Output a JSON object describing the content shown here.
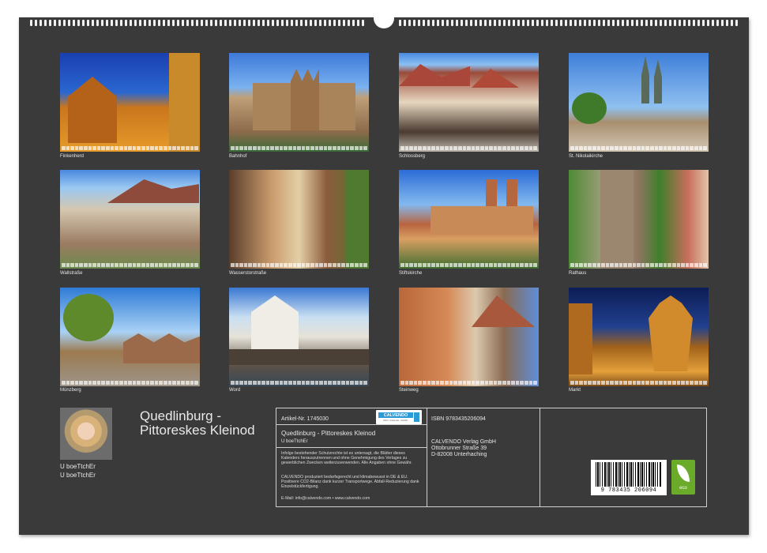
{
  "tiles": [
    {
      "label": "Finkenherd"
    },
    {
      "label": "Bahnhof"
    },
    {
      "label": "Schlossberg"
    },
    {
      "label": "St. Nikolaikirche"
    },
    {
      "label": "Wallstraße"
    },
    {
      "label": "Wasserstorstraße"
    },
    {
      "label": "Stiftskirche"
    },
    {
      "label": "Rathaus"
    },
    {
      "label": "Münzberg"
    },
    {
      "label": "Word"
    },
    {
      "label": "Steinweg"
    },
    {
      "label": "Markt"
    }
  ],
  "author": {
    "line1": "U boeTtchEr",
    "line2": "U boeTtchEr"
  },
  "title": "Quedlinburg - Pittoreskes Kleinod",
  "info": {
    "article": "Artikel-Nr. 1745030",
    "isbn": "ISBN 9783435206094",
    "product_title": "Quedlinburg - Pittoreskes Kleinod",
    "product_author": "U boeTtchEr",
    "copyright_text": "Infolge bestehender Schutzrechte ist es untersagt, die Blätter dieses Kalenders herauszutrennen und ohne Genehmigung des Verlages zu gewerblichen Zwecken weiterzuverwenden. Alle Angaben ohne Gewähr.",
    "climate_text": "CALVENDO produziert bedarfsgerecht und klimabewusst in DE & EU. Positivere CO2-Bilanz dank kurzer Transportwege. Abfall-Reduzierung dank Einzelstückfertigung.",
    "contact": "E-Mail: info@calvendo.com • www.calvendo.com",
    "publisher": "CALVENDO Verlag GmbH",
    "street": "Ottobrunner Straße 39",
    "city": "D-82008 Unterhaching",
    "logo_text": "CALVENDO",
    "logo_sub": "Mehr. Kalender. Vielfalt.",
    "barcode_number": "9 783435 206094",
    "eco_label": "eco"
  },
  "colors": {
    "sheet": "#3a3a3a",
    "text": "#e6e6e6",
    "calvendo_blue": "#2c9ad7",
    "eco_green": "#6aab2a"
  }
}
